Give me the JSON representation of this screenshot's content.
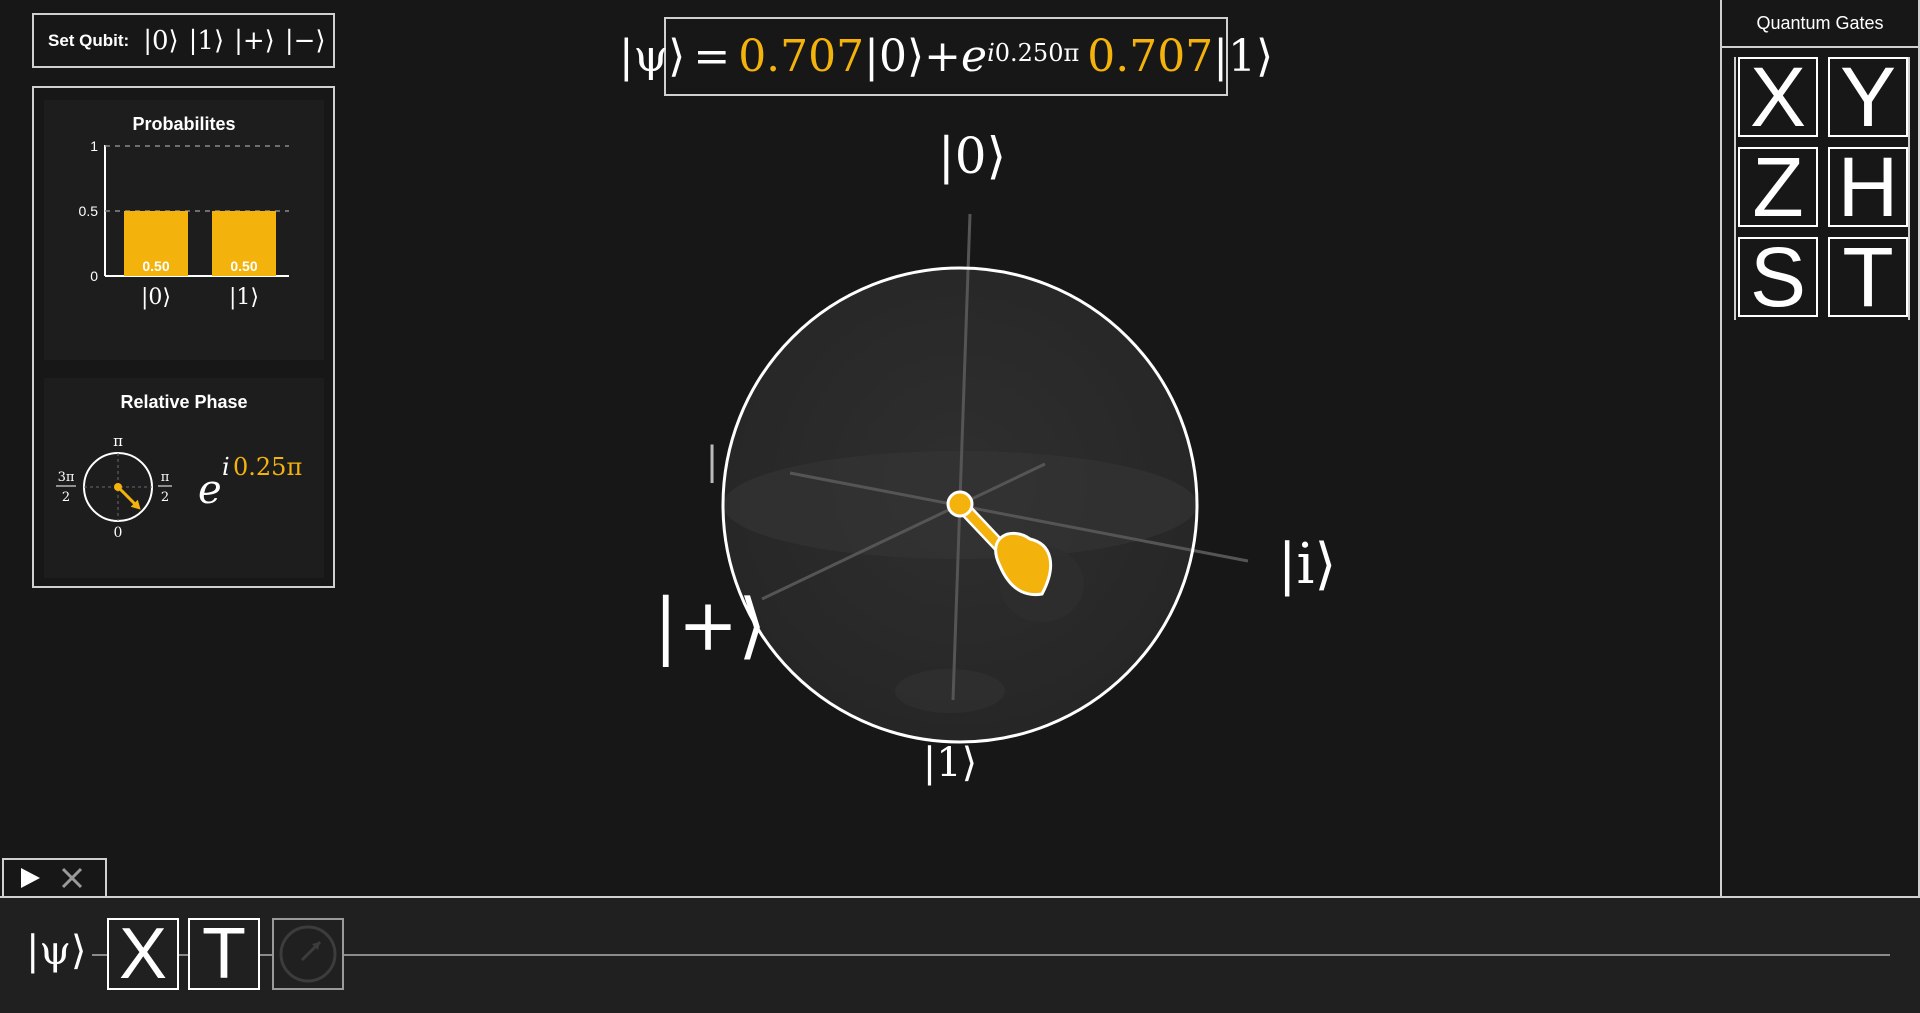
{
  "set_qubit": {
    "label": "Set Qubit:",
    "options": [
      "|0⟩",
      "|1⟩",
      "|+⟩",
      "|−⟩"
    ]
  },
  "state": {
    "psi": "|ψ⟩",
    "equals": "=",
    "alpha": "0.707",
    "ket0": "|0⟩",
    "plus": "+",
    "e": "e",
    "phase_i": "i",
    "phase_value": "0.250π",
    "beta": "0.707",
    "ket1": "|1⟩"
  },
  "probabilities": {
    "title": "Probabilites",
    "y_ticks": [
      "0",
      "0.5",
      "1"
    ],
    "bars": [
      {
        "label": "|0⟩",
        "value": 0.5,
        "value_label": "0.50"
      },
      {
        "label": "|1⟩",
        "value": 0.5,
        "value_label": "0.50"
      }
    ],
    "color": "#f4b30c"
  },
  "relative_phase": {
    "title": "Relative Phase",
    "labels": {
      "top": "π",
      "bottom": "0",
      "right_num": "π",
      "right_den": "2",
      "left_num": "3π",
      "left_den": "2"
    },
    "e": "e",
    "i": "i",
    "value": "0.25π",
    "phase_fraction": 0.25
  },
  "bloch": {
    "labels": {
      "zero": "|0⟩",
      "one": "|1⟩",
      "plus": "|+⟩",
      "i": "|i⟩",
      "hidden_partial": "|"
    },
    "vector_color": "#f4b30c"
  },
  "gates_panel": {
    "title": "Quantum Gates",
    "gates": [
      "X",
      "Y",
      "Z",
      "H",
      "S",
      "T"
    ]
  },
  "controls": {
    "play_icon": "play-icon",
    "clear_icon": "close-icon"
  },
  "circuit": {
    "input_label": "|ψ⟩",
    "gates": [
      "X",
      "T"
    ],
    "measure_icon": "measurement-dial-icon"
  },
  "colors": {
    "background": "#171717",
    "accent": "#f4b30c",
    "border": "#d0d0d0"
  }
}
